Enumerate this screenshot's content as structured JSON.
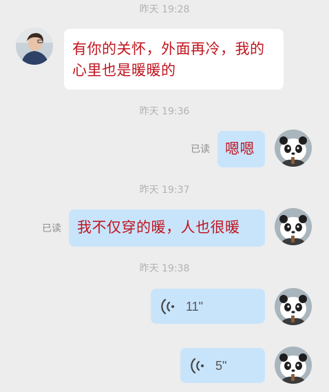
{
  "conversation": {
    "timestamps": [
      "昨天 19:28",
      "昨天 19:36",
      "昨天 19:37",
      "昨天 19:38"
    ],
    "messages": [
      {
        "id": "m1",
        "side": "left",
        "type": "text",
        "text": "有你的关怀，外面再冷，我的心里也是暖暖的"
      },
      {
        "id": "m2",
        "side": "right",
        "type": "text",
        "text": "嗯嗯",
        "read": "已读"
      },
      {
        "id": "m3",
        "side": "right",
        "type": "text",
        "text": "我不仅穿的暖，人也很暖",
        "read": "已读"
      },
      {
        "id": "m4",
        "side": "right",
        "type": "voice",
        "duration": "11\"",
        "icon": "voice-wave-icon"
      },
      {
        "id": "m5",
        "side": "right",
        "type": "voice",
        "duration": "5\"",
        "icon": "voice-wave-icon"
      }
    ]
  },
  "colors": {
    "background": "#ededed",
    "incoming_bubble": "#ffffff",
    "outgoing_bubble": "#c8e4fb",
    "message_text": "#c0141e",
    "timestamp_text": "#b2b2b2"
  },
  "avatars": {
    "contact": "contact-avatar",
    "self": "panda-avatar"
  }
}
